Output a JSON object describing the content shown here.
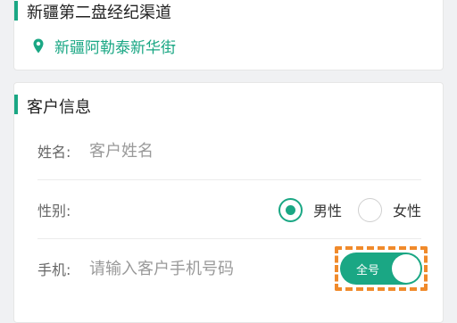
{
  "colors": {
    "accent": "#1aa784",
    "highlight_dashed": "#f08a2b"
  },
  "store_card": {
    "title": "新疆第二盘经纪渠道",
    "location_icon": "map-pin-icon",
    "location_text": "新疆阿勒泰新华街"
  },
  "customer_card": {
    "title": "客户信息",
    "name": {
      "label": "姓名:",
      "placeholder": "客户姓名",
      "value": ""
    },
    "gender": {
      "label": "性别:",
      "options": [
        "男性",
        "女性"
      ],
      "selected": "男性"
    },
    "phone": {
      "label": "手机:",
      "placeholder": "请输入客户手机号码",
      "value": "",
      "toggle_label": "全号",
      "toggle_on": true
    }
  }
}
